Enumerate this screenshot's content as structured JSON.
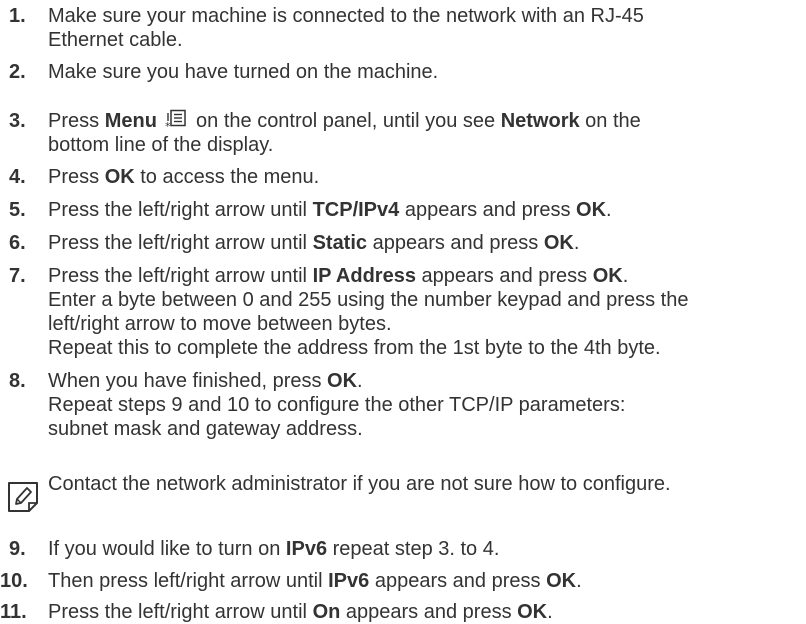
{
  "icons": {
    "menu": "menu-icon",
    "note": "note-pencil-icon"
  },
  "steps": [
    {
      "num": "1.",
      "lines": [
        "Make sure your machine is connected to the network with an RJ-45",
        "Ethernet cable."
      ]
    },
    {
      "num": "2.",
      "lines": [
        "Make sure you have turned on the machine."
      ]
    },
    {
      "num": "3.",
      "a": "Press ",
      "b1": "Menu",
      "c": " on the control panel, until you see ",
      "b2": "Network",
      "d": " on the",
      "line2": "bottom line of the display."
    },
    {
      "num": "4.",
      "a": "Press ",
      "b1": "OK",
      "c": " to access the menu."
    },
    {
      "num": "5.",
      "a": "Press the left/right arrow until ",
      "b1": "TCP/IPv4",
      "c": " appears and press ",
      "b2": "OK",
      "d": "."
    },
    {
      "num": "6.",
      "a": "Press the left/right arrow until ",
      "b1": "Static",
      "c": " appears and press ",
      "b2": "OK",
      "d": "."
    },
    {
      "num": "7.",
      "a": "Press the left/right arrow until ",
      "b1": "IP Address",
      "c": " appears and press ",
      "b2": "OK",
      "d": ".",
      "more": [
        "Enter a byte between 0 and 255 using the number keypad and press the",
        "left/right arrow  to move between bytes.",
        "Repeat this to complete the address from the 1st byte to the 4th byte."
      ]
    },
    {
      "num": "8.",
      "a": "When you have finished, press ",
      "b1": "OK",
      "c": ".",
      "more": [
        "Repeat steps 9 and 10 to configure the other TCP/IP parameters:",
        "subnet mask and gateway address."
      ]
    },
    {
      "num": "9.",
      "a": "If you would like to turn on ",
      "b1": "IPv6",
      "c": " repeat step 3. to 4."
    },
    {
      "num": "10.",
      "a": "Then press left/right arrow until ",
      "b1": "IPv6",
      "c": " appears and press ",
      "b2": "OK",
      "d": "."
    },
    {
      "num": "11.",
      "a": "Press the left/right arrow until ",
      "b1": "On",
      "c": " appears and press ",
      "b2": "OK",
      "d": "."
    }
  ],
  "note": {
    "text": "Contact the network administrator if you are not sure how to configure."
  }
}
